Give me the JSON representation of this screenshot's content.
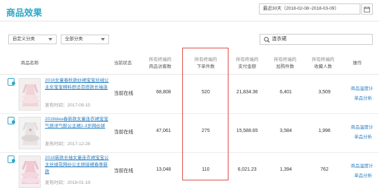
{
  "header": {
    "title": "商品效果",
    "date_range": "最近30天（2018-02-08~2018-03-09）"
  },
  "filters": {
    "category_custom": "自定义分类",
    "category_all": "全部分类",
    "search_value": "连衣裙"
  },
  "columns": {
    "name": "商品名称",
    "status": "当前状态",
    "visitors": [
      "所有终端的",
      "商品访客数"
    ],
    "orders": [
      "所有终端的",
      "下单件数"
    ],
    "pay_amount": [
      "所有终端的",
      "支付金额"
    ],
    "cart_count": [
      "所有终端的",
      "加购件数"
    ],
    "fav_count": [
      "所有终端的",
      "收藏人数"
    ],
    "action": "操作"
  },
  "rows": [
    {
      "name": "2018女童春秋款纱裙宝宝丝绒公主女宝宝棉料舒适百搭款长袖连",
      "publish_time": "发布时间：2017-09-15",
      "status": "当前在线",
      "visitors": "68,808",
      "orders": "520",
      "pay_amount": "21,834.36",
      "cart_count": "6,401",
      "fav_count": "3,509",
      "action_1": "商品温度计",
      "action_2": "单品分析"
    },
    {
      "name": "2018idea春新款女童连衣裙宝宝气质洋气鲜公主裙1-3岁网纱拼",
      "publish_time": "发布时间：2017-12-28",
      "status": "当前在线",
      "visitors": "47,061",
      "orders": "275",
      "pay_amount": "15,588.65",
      "cart_count": "3,584",
      "fav_count": "1,996",
      "action_1": "商品温度计",
      "action_2": "单品分析"
    },
    {
      "name": "2018新款长袖女童连衣裙宝宝公主丝绒花网纱公主拼接裙春季新款",
      "publish_time": "发布时间：2018-01-19",
      "status": "当前在线",
      "visitors": "13,048",
      "orders": "110",
      "pay_amount": "6,021.23",
      "cart_count": "1,394",
      "fav_count": "762",
      "action_1": "商品温度计",
      "action_2": "单品分析"
    }
  ],
  "colors": {
    "accent": "#2aa7c9",
    "link": "#2a7fc2",
    "highlight_border": "#e04a4a"
  },
  "icons": {
    "calendar": "calendar-icon",
    "search": "search-icon",
    "row_flag": "mobile-flag-icon"
  }
}
